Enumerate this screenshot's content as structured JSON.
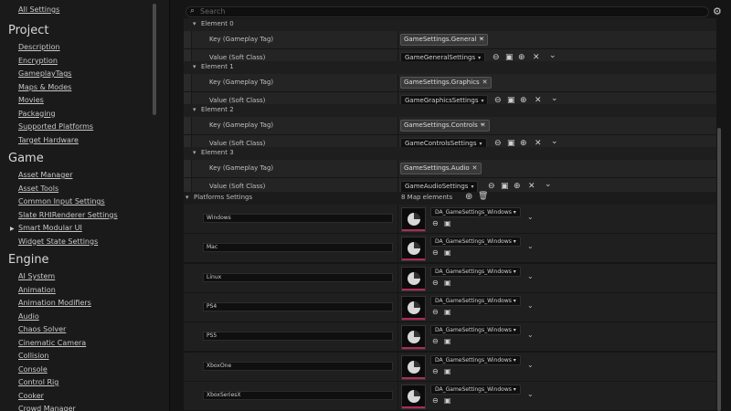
{
  "sidebar": {
    "all_settings": "All Settings",
    "sections": [
      {
        "title": "Project",
        "items": [
          "Description",
          "Encryption",
          "GameplayTags",
          "Maps & Modes",
          "Movies",
          "Packaging",
          "Supported Platforms",
          "Target Hardware"
        ]
      },
      {
        "title": "Game",
        "items": [
          "Asset Manager",
          "Asset Tools",
          "Common Input Settings",
          "Slate RHIRenderer Settings",
          "Smart Modular UI",
          "Widget State Settings"
        ]
      },
      {
        "title": "Engine",
        "items": [
          "AI System",
          "Animation",
          "Animation Modifiers",
          "Audio",
          "Chaos Solver",
          "Cinematic Camera",
          "Collision",
          "Console",
          "Control Rig",
          "Cooker",
          "Crowd Manager"
        ]
      }
    ]
  },
  "search": {
    "placeholder": "Search"
  },
  "labels": {
    "key": "Key (Gameplay Tag)",
    "value": "Value (Soft Class)"
  },
  "elements": [
    {
      "header": "Element 0",
      "tag": "GameSettings.General",
      "class": "GameGeneralSettings"
    },
    {
      "header": "Element 1",
      "tag": "GameSettings.Graphics",
      "class": "GameGraphicsSettings"
    },
    {
      "header": "Element 2",
      "tag": "GameSettings.Controls",
      "class": "GameControlsSettings"
    },
    {
      "header": "Element 3",
      "tag": "GameSettings.Audio",
      "class": "GameAudioSettings"
    }
  ],
  "platforms": {
    "header": "Platforms Settings",
    "count": "8 Map elements",
    "rows": [
      {
        "name": "Windows",
        "asset": "DA_GameSettings_Windows"
      },
      {
        "name": "Mac",
        "asset": "DA_GameSettings_Windows"
      },
      {
        "name": "Linux",
        "asset": "DA_GameSettings_Windows"
      },
      {
        "name": "PS4",
        "asset": "DA_GameSettings_Windows"
      },
      {
        "name": "PS5",
        "asset": "DA_GameSettings_Windows"
      },
      {
        "name": "XboxOne",
        "asset": "DA_GameSettings_Windows"
      },
      {
        "name": "XboxSeriesX",
        "asset": "DA_GameSettings_Windows"
      }
    ]
  },
  "colors": {
    "thumb_accent": "#b02a5a",
    "background": "#151515"
  },
  "icons": [
    "search-icon",
    "gear-icon",
    "clear-icon",
    "chevron-down-icon",
    "use-selected-icon",
    "browse-icon",
    "add-icon",
    "delete-icon",
    "trash-icon"
  ]
}
